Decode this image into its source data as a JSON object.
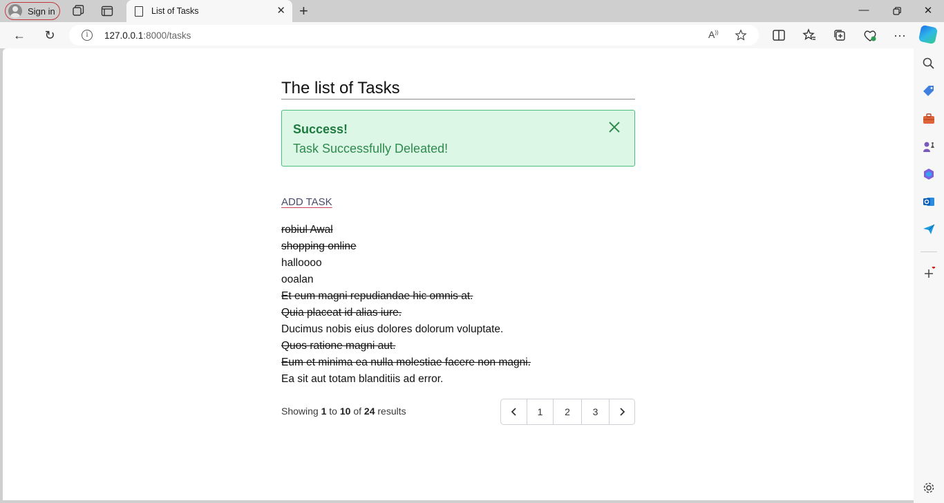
{
  "browser": {
    "sign_in_label": "Sign in",
    "tab_title": "List of Tasks",
    "url_host": "127.0.0.1",
    "url_path": ":8000/tasks"
  },
  "page": {
    "title": "The list of Tasks",
    "alert": {
      "title": "Success!",
      "message": "Task Successfully Deleated!"
    },
    "add_task_label": "ADD TASK",
    "tasks": [
      {
        "name": "robiul Awal",
        "completed": true
      },
      {
        "name": "shopping online",
        "completed": true
      },
      {
        "name": "halloooo",
        "completed": false
      },
      {
        "name": "ooalan",
        "completed": false
      },
      {
        "name": "Et eum magni repudiandae hic omnis at.",
        "completed": true
      },
      {
        "name": "Quia placeat id alias iure.",
        "completed": true
      },
      {
        "name": "Ducimus nobis eius dolores dolorum voluptate.",
        "completed": false
      },
      {
        "name": "Quos ratione magni aut.",
        "completed": true
      },
      {
        "name": "Eum et minima ea nulla molestiae facere non magni.",
        "completed": true
      },
      {
        "name": "Ea sit aut totam blanditiis ad error.",
        "completed": false
      }
    ],
    "pagination": {
      "showing": "Showing",
      "from": "1",
      "to_word": "to",
      "to": "10",
      "of_word": "of",
      "total": "24",
      "results_word": "results",
      "pages": [
        "1",
        "2",
        "3"
      ]
    }
  },
  "colors": {
    "alert_bg": "#dcf7e6",
    "alert_border": "#49c07a",
    "alert_text": "#1e7a3e"
  }
}
